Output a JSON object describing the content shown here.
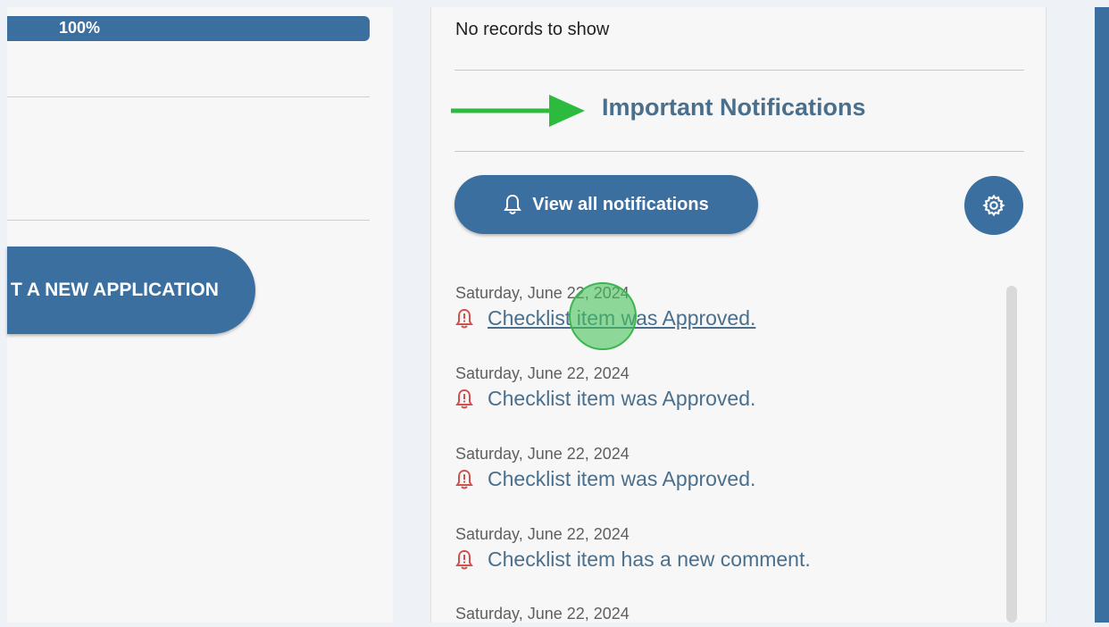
{
  "left": {
    "progress": {
      "label": "100%",
      "value": 1.0
    },
    "start_application_button": "T A NEW APPLICATION"
  },
  "middle": {
    "no_records": "No records to show",
    "notifications_title": "Important Notifications",
    "view_all_button": "View all notifications",
    "notifications": [
      {
        "date": "Saturday, June 22, 2024",
        "text": "Checklist item was Approved."
      },
      {
        "date": "Saturday, June 22, 2024",
        "text": "Checklist item was Approved."
      },
      {
        "date": "Saturday, June 22, 2024",
        "text": "Checklist item was Approved."
      },
      {
        "date": "Saturday, June 22, 2024",
        "text": "Checklist item has a new comment."
      },
      {
        "date": "Saturday, June 22, 2024",
        "text": ""
      }
    ]
  },
  "icons": {
    "bell": "bell-icon",
    "alert_bell": "alert-bell-icon",
    "gear": "gear-icon",
    "arrow": "arrow-right-icon"
  },
  "colors": {
    "primary": "#3a6fa0",
    "link": "#4a6f8c",
    "alert": "#d0524e",
    "pointer": "#3cb54e"
  }
}
